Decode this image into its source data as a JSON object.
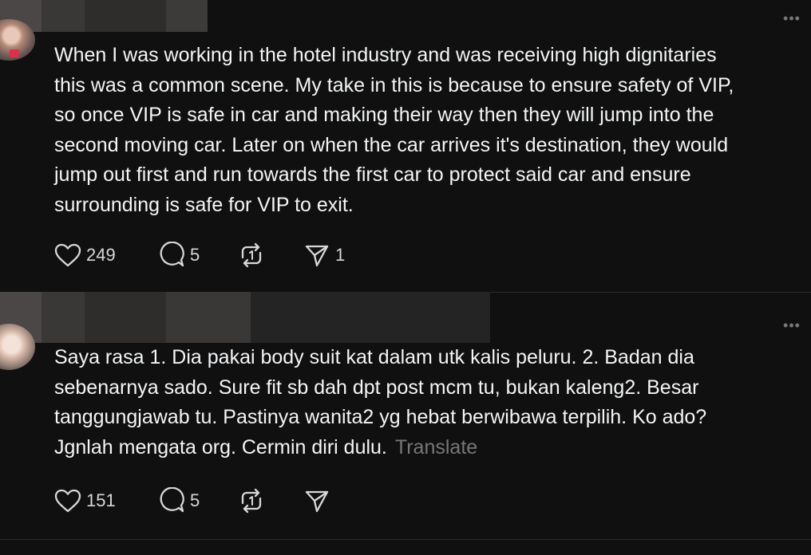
{
  "posts": [
    {
      "text": "When I was working in the hotel industry and was receiving high dignitaries\nthis was a common scene. My take in this is because to ensure safety of VIP,\nso once VIP is safe in car and making their way then they will jump into the\nsecond moving car. Later on when the car arrives it's destination, they would\njump out first and run towards the first car to protect said car and ensure\nsurrounding is safe for VIP to exit.",
      "translate_label": "",
      "more_label": "•••",
      "likes": "249",
      "replies": "5",
      "reposts": "",
      "shares": "1"
    },
    {
      "text": "Saya rasa 1. Dia pakai body suit kat dalam utk kalis peluru. 2. Badan dia\nsebenarnya sado. Sure fit sb dah dpt post mcm tu, bukan kaleng2. Besar\ntanggungjawab tu. Pastinya wanita2 yg hebat berwibawa terpilih. Ko ado?\nJgnlah mengata org. Cermin diri dulu.",
      "translate_label": "Translate",
      "more_label": "•••",
      "likes": "151",
      "replies": "5",
      "reposts": "",
      "shares": ""
    }
  ],
  "icons": {
    "like": "heart-icon",
    "reply": "comment-icon",
    "repost": "repost-icon",
    "share": "send-icon",
    "more": "more-icon"
  },
  "colors": {
    "background": "#101010",
    "text": "#f3f5f7",
    "muted": "#777777"
  }
}
